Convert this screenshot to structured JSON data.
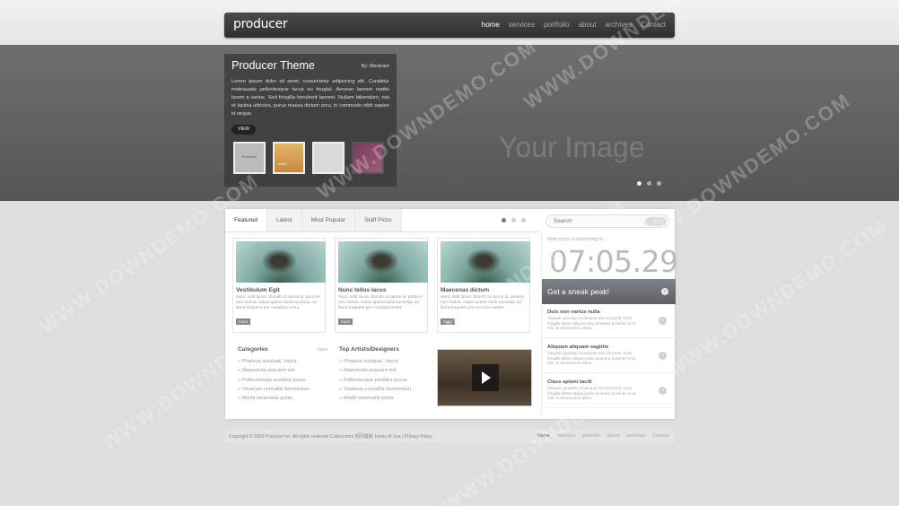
{
  "header": {
    "logo": "producer",
    "nav": [
      "home",
      "services",
      "portfolio",
      "about",
      "archives",
      "Contact"
    ]
  },
  "hero": {
    "title": "Producer Theme",
    "byline": "By: Abraham",
    "description": "Lorem ipsum dolor sit amet, consectetur adipiscing elit. Curabitur malesuada pellentesque lacus eu feugiat. Aenean laoreet mattis lorem a varius. Sed fringilla hendrerit laoreet. Nullam bibendum, nisi et lacinia ultricies, purus massa dictum arcu, in commodo nibh sapien id neque.",
    "view_label": "VIEW",
    "placeholder": "Your Image",
    "thumb1_label": "Producer",
    "thumb2_label": "more"
  },
  "tabs": [
    "Featured",
    "Latest",
    "Most Popular",
    "Staff Picks"
  ],
  "search": {
    "placeholder": "Search",
    "button": "Go"
  },
  "posts": [
    {
      "title": "Vestibulum Egit",
      "text": "Nunc nelit lacus, blandit ut varius id, pretium non metus. Class aptent taciti sociosqu ad litora torquent per conubia nostra",
      "more": "more"
    },
    {
      "title": "Nunc tellus lacus",
      "text": "Nunc nelit lacus, blandit ut varius id, pretium non metus. Class aptent taciti sociosqu ad litora torquent per conubia nostra",
      "more": "more"
    },
    {
      "title": "Maecenas dictum",
      "text": "Nunc nelit lacus, blandit ut varius id, pretium non metus. Class aptent taciti sociosqu ad litora torquent per conubia nostra",
      "more": "more"
    }
  ],
  "categories": {
    "title": "Categories",
    "more": "more",
    "items": [
      "Phaleus volutpat, Vesut",
      "Maecenas posuere est",
      "Pellentesque porttitor purus",
      "Vivamus convallis fermentum",
      "Morbi venenatis porta"
    ]
  },
  "artists": {
    "title": "Top Artists/Designers",
    "items": [
      "Phaleus volutpat, Vesut",
      "Maecenas posuere est",
      "Pellentesque porttitor purus",
      "Vivamus convallis fermentum",
      "Morbi venenatis porta"
    ]
  },
  "sidebar": {
    "launch_text": "New product launching in...",
    "clock": "07:05.29",
    "sneak_label": "Get a sneak peak!",
    "news": [
      {
        "title": "Duis non varius nulla",
        "text": "Aliquam gravida consequat nisi vel porta. Duis fringilla libero aliquet ante pharetra pulvinar et at nisl. In elementum tellus."
      },
      {
        "title": "Aliquam aliquam sagittis",
        "text": "Aliquam gravida consequat nisi vel porta. Duis fringilla libero aliquet ante pharetra pulvinar et at nisl. In elementum tellus."
      },
      {
        "title": "Class aptent taciti",
        "text": "Aliquam gravida consequat nisi vel porta. Duis fringilla libero aliquet ante pharetra pulvinar et at nisl. In elementum tellus."
      }
    ]
  },
  "footer": {
    "copyright": "Copyright © 2009 Producer Inc. All rights reserved Collect from 网页模板 Terms of Use | Privacy Policy",
    "nav": [
      "home",
      "services",
      "portfolio",
      "about",
      "archives",
      "Contact"
    ]
  },
  "watermark": "WWW.DOWNDEMO.COM"
}
